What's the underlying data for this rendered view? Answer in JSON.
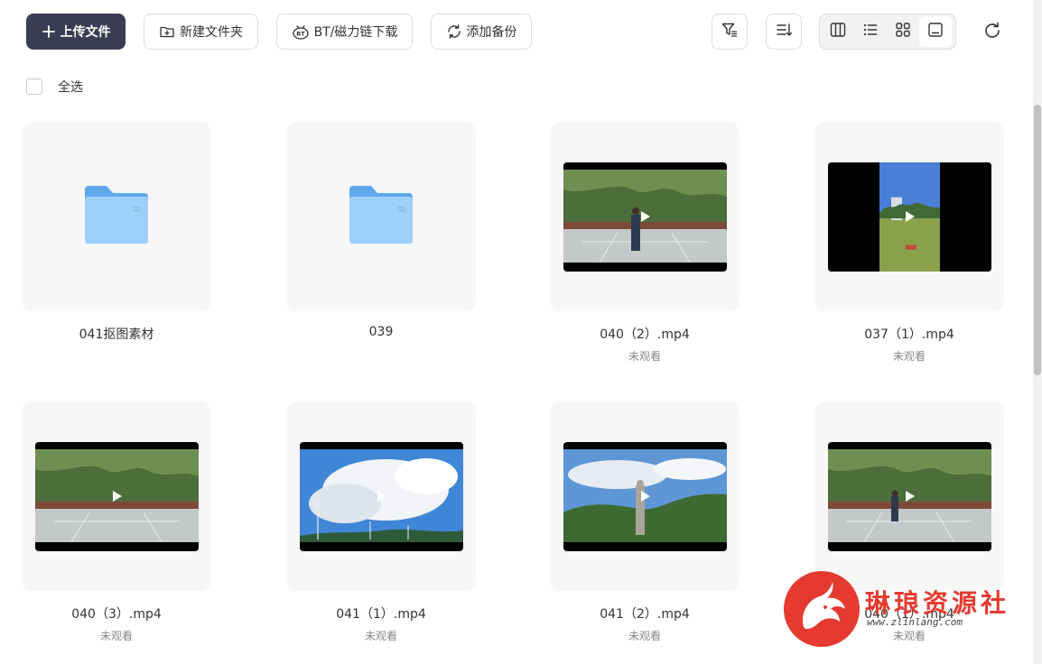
{
  "toolbar": {
    "upload_label": "上传文件",
    "new_folder_label": "新建文件夹",
    "bt_label": "BT/磁力链下载",
    "backup_label": "添加备份",
    "icons": [
      "filter-icon",
      "sort-icon",
      "column-view-icon",
      "list-view-icon",
      "grid-view-icon",
      "single-view-icon",
      "refresh-icon"
    ]
  },
  "select_all_label": "全选",
  "items": [
    {
      "name": "041抠图素材",
      "type": "folder",
      "status": ""
    },
    {
      "name": "039",
      "type": "folder",
      "status": ""
    },
    {
      "name": "040（2）.mp4",
      "type": "video",
      "status": "未观看"
    },
    {
      "name": "037（1）.mp4",
      "type": "video",
      "status": "未观看"
    },
    {
      "name": "040（3）.mp4",
      "type": "video",
      "status": "未观看"
    },
    {
      "name": "041（1）.mp4",
      "type": "video",
      "status": "未观看"
    },
    {
      "name": "041（2）.mp4",
      "type": "video",
      "status": "未观看"
    },
    {
      "name": "040（1）.mp4",
      "type": "video",
      "status": "未观看"
    }
  ],
  "watermark": {
    "title": "琳琅资源社",
    "url": "www.zlinlang.com"
  },
  "colors": {
    "primary": "#3a3d52",
    "folder": "#7fbcf2",
    "watermark": "#e53a2f"
  }
}
